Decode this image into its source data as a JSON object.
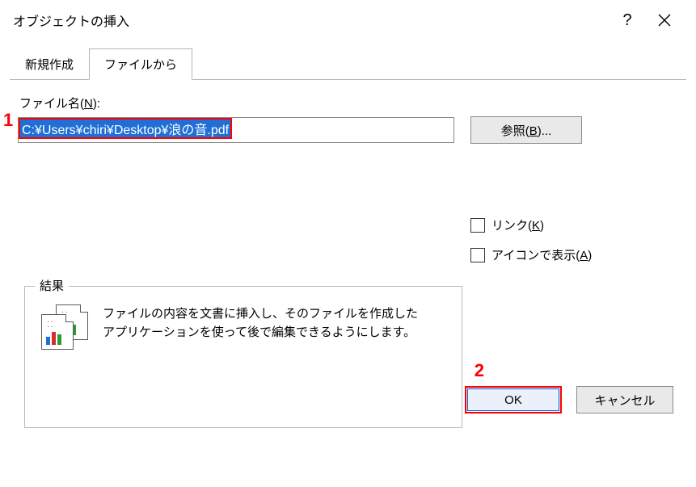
{
  "window": {
    "title": "オブジェクトの挿入",
    "help_label": "?",
    "close_label": "×"
  },
  "tabs": {
    "new": "新規作成",
    "from_file": "ファイルから"
  },
  "filename": {
    "label_pre": "ファイル名(",
    "label_key": "N",
    "label_post": "):",
    "value": "C:¥Users¥chiri¥Desktop¥浪の音.pdf"
  },
  "browse": {
    "label_pre": "参照(",
    "label_key": "B",
    "label_post": ")..."
  },
  "checks": {
    "link_pre": "リンク(",
    "link_key": "K",
    "link_post": ")",
    "icon_pre": "アイコンで表示(",
    "icon_key": "A",
    "icon_post": ")"
  },
  "result": {
    "legend": "結果",
    "text": "ファイルの内容を文書に挿入し、そのファイルを作成したアプリケーションを使って後で編集できるようにします。"
  },
  "buttons": {
    "ok": "OK",
    "cancel": "キャンセル"
  },
  "annotations": {
    "one": "1",
    "two": "2"
  }
}
